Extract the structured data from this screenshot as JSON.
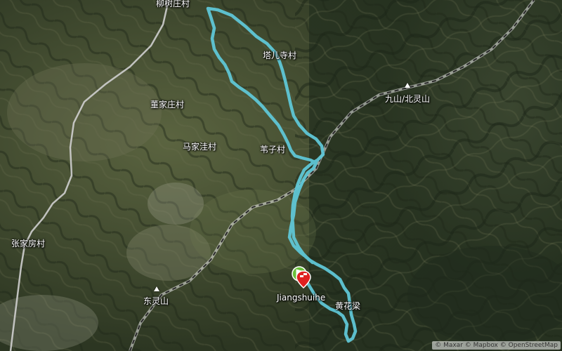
{
  "map": {
    "places": {
      "liushuzhuang": "柳树庄村",
      "taersi": "塔儿寺村",
      "dongjiazhuang": "董家庄村",
      "majiawa": "马家洼村",
      "weizi": "苇子村",
      "zhangjiafang": "张家房村",
      "jiangshuihe": "Jiangshuihe",
      "huanghualiang": "黄花梁"
    },
    "peaks": {
      "jiushan": "九山/北灵山",
      "dongling": "东灵山"
    },
    "attribution": "© Maxar © Mapbox © OpenStreetMap",
    "colors": {
      "track": "#5fc6d6",
      "road": "#d9d9d9",
      "railway": "#3a3a3a",
      "start_marker": "#6abf3a",
      "end_marker": "#e02020"
    },
    "icons": {
      "start": "start-flag-icon",
      "end": "finish-pin-icon",
      "peak": "peak-triangle-icon"
    }
  }
}
